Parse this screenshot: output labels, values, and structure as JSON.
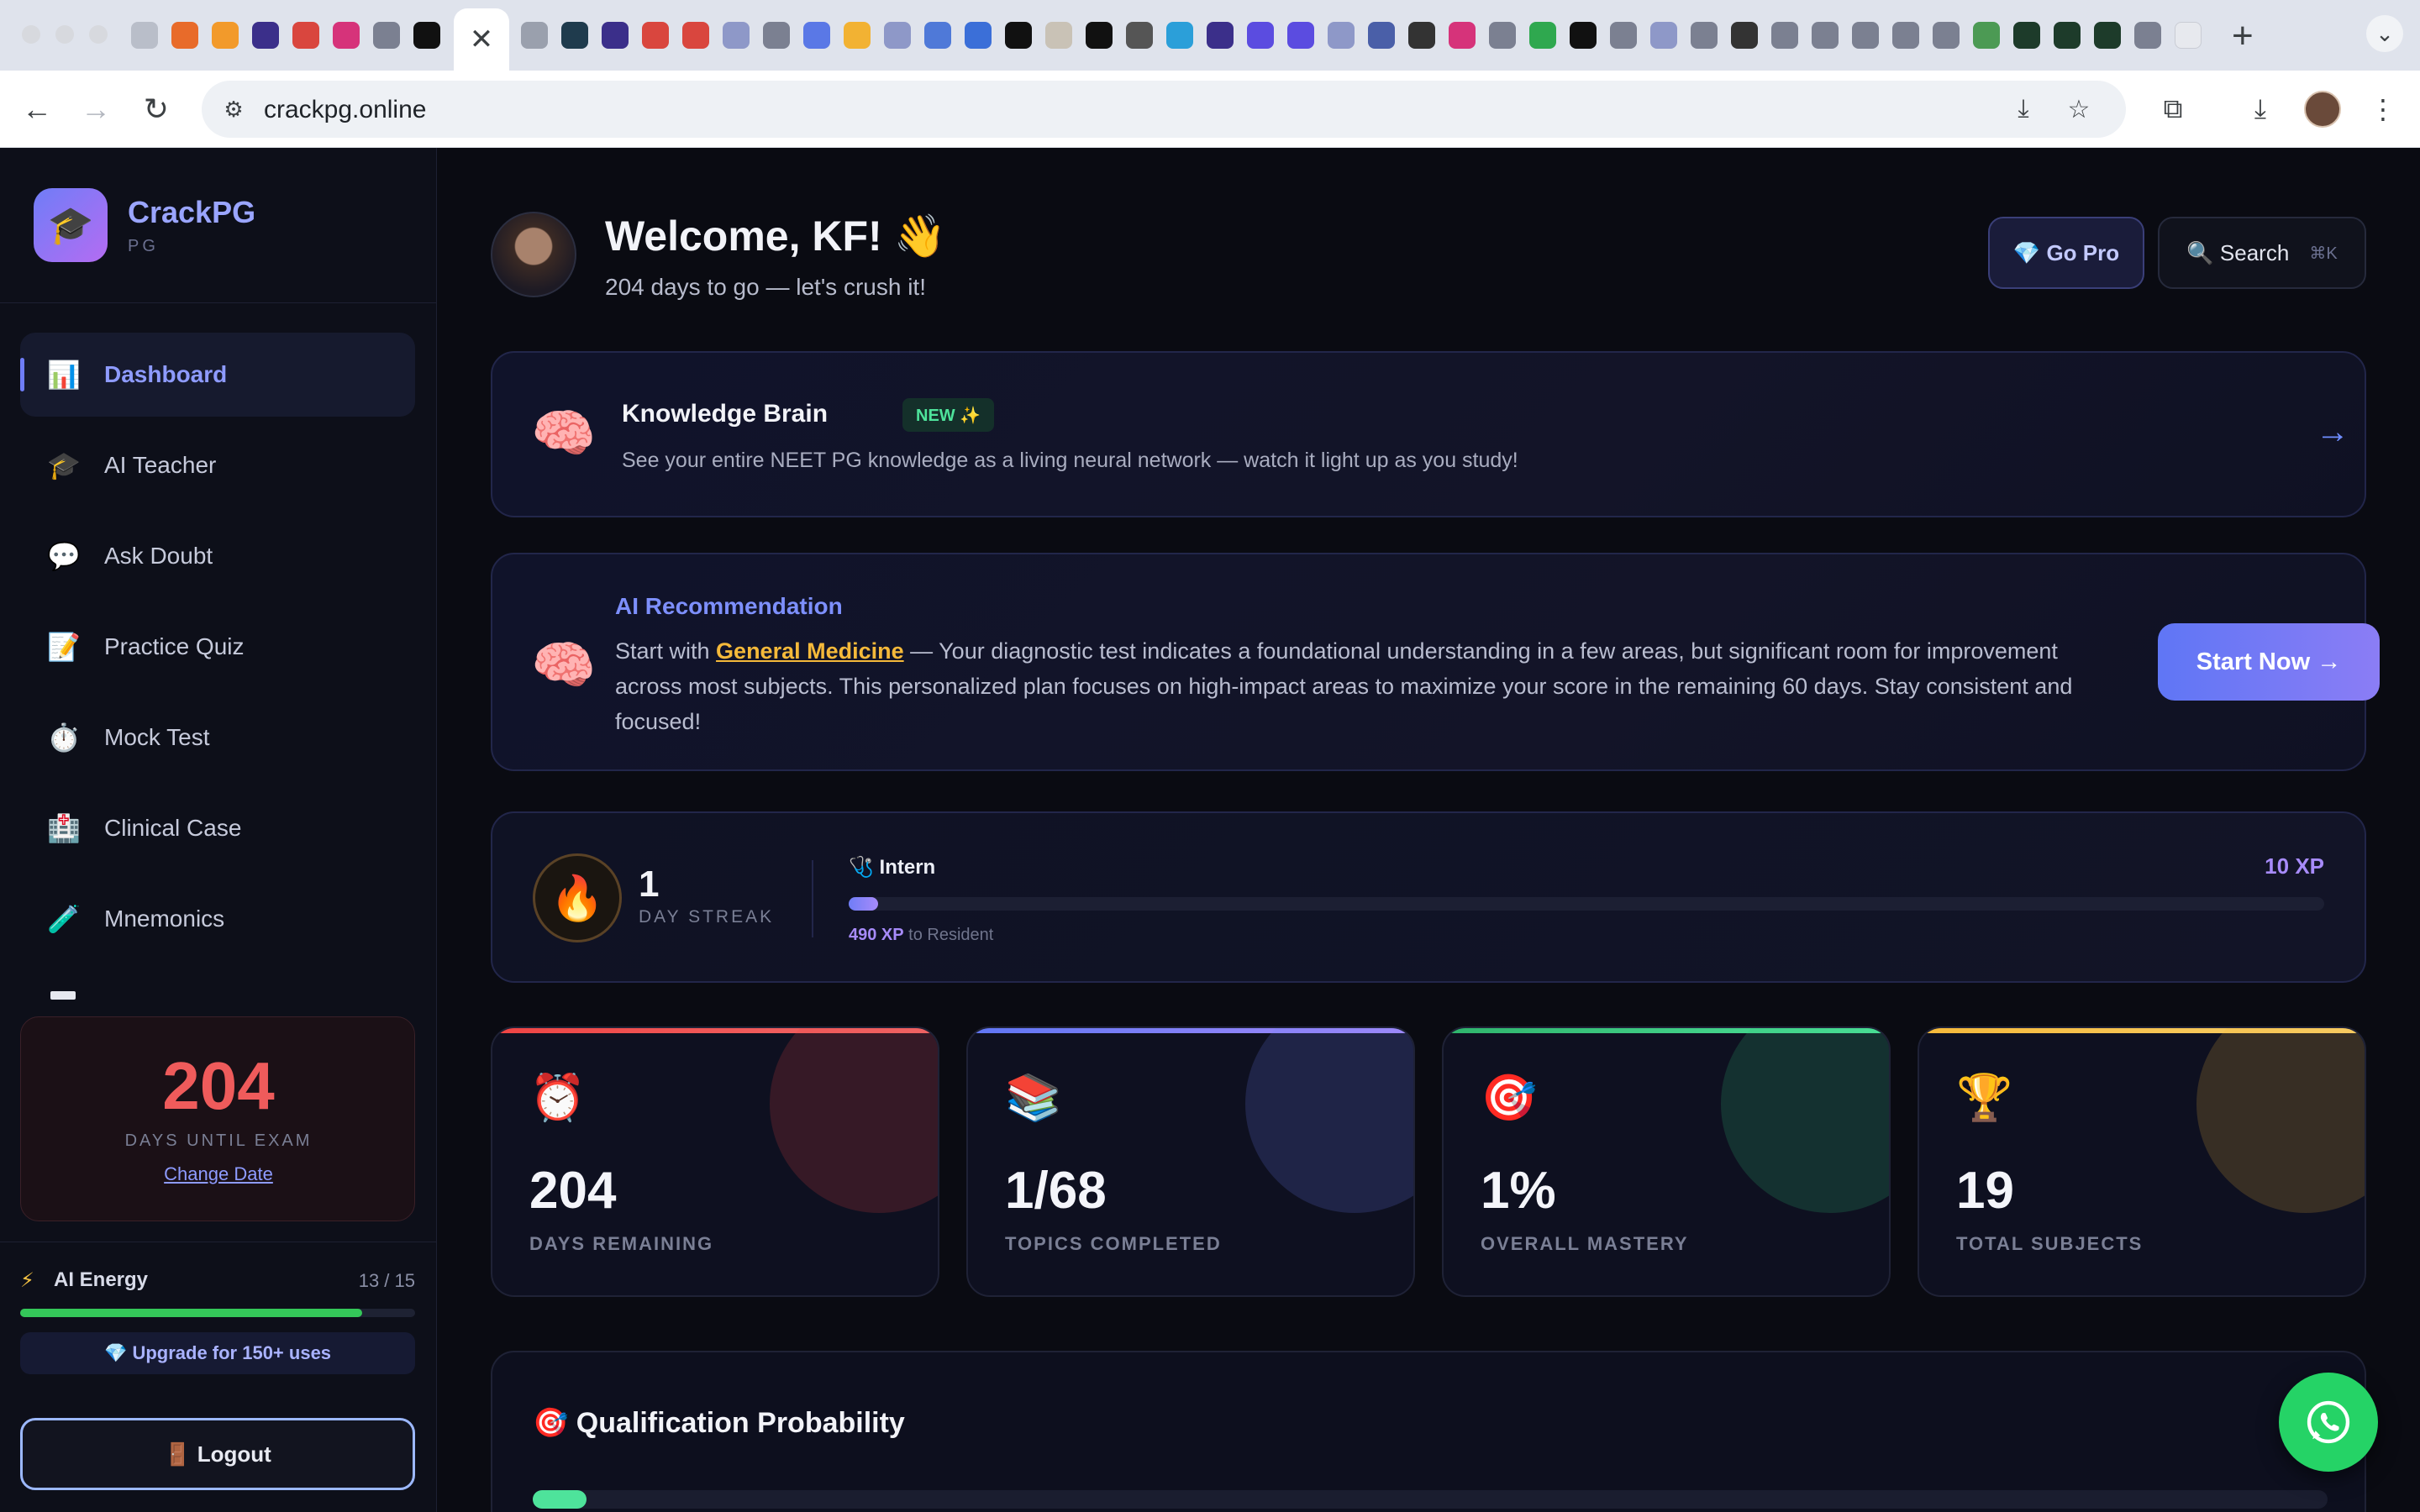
{
  "browser": {
    "active_tab_close": "✕",
    "url": "crackpg.online"
  },
  "sidebar": {
    "brand_name": "CrackPG",
    "brand_sub": "PG",
    "items": [
      {
        "label": "Dashboard",
        "icon": "📊"
      },
      {
        "label": "AI Teacher",
        "icon": "🎓"
      },
      {
        "label": "Ask Doubt",
        "icon": "💬"
      },
      {
        "label": "Practice Quiz",
        "icon": "📝"
      },
      {
        "label": "Mock Test",
        "icon": "⏱️"
      },
      {
        "label": "Clinical Case",
        "icon": "🏥"
      },
      {
        "label": "Mnemonics",
        "icon": "🧪"
      }
    ],
    "countdown": {
      "value": "204",
      "label": "DAYS UNTIL EXAM",
      "link": "Change Date"
    },
    "energy": {
      "title": "AI Energy",
      "count": "13 / 15",
      "fraction": 0.867,
      "upgrade": "💎 Upgrade for 150+ uses"
    },
    "logout": "🚪 Logout"
  },
  "header": {
    "welcome": "Welcome, KF! 👋",
    "subtitle": "204 days to go — let's crush it!",
    "go_pro": "💎 Go Pro",
    "search": "🔍 Search",
    "search_kbd": "⌘K"
  },
  "knowledge_brain": {
    "icon": "🧠",
    "title": "Knowledge Brain",
    "badge": "NEW ✨",
    "description": "See your entire NEET PG knowledge as a living neural network — watch it light up as you study!",
    "arrow": "→"
  },
  "ai_recommendation": {
    "icon": "🧠",
    "title": "AI Recommendation",
    "text_prefix": "Start with ",
    "subject": "General Medicine",
    "text_suffix": " — Your diagnostic test indicates a foundational understanding in a few areas, but significant room for improvement across most subjects. This personalized plan focuses on high-impact areas to maximize your score in the remaining 60 days. Stay consistent and focused!",
    "button": "Start Now →"
  },
  "streak": {
    "icon": "🔥",
    "value": "1",
    "label": "DAY STREAK",
    "rank": "🩺 Intern",
    "xp": "10 XP",
    "xp_progress": 0.02,
    "xp_needed": "490 XP",
    "xp_next": " to Resident"
  },
  "stats": [
    {
      "icon": "⏰",
      "value": "204",
      "label": "DAYS REMAINING",
      "color": "#ef4444"
    },
    {
      "icon": "📚",
      "value": "1/68",
      "label": "TOPICS COMPLETED",
      "color": "#6f7df7"
    },
    {
      "icon": "🎯",
      "value": "1%",
      "label": "OVERALL MASTERY",
      "color": "#34c77b"
    },
    {
      "icon": "🏆",
      "value": "19",
      "label": "TOTAL SUBJECTS",
      "color": "#f5b93a"
    }
  ],
  "qualification": {
    "title": "🎯 Qualification Probability",
    "value": "5",
    "progress": 0.03
  },
  "colors": {
    "accent": "#6f7df7",
    "danger": "#ef5b5b",
    "success": "#4ee39b",
    "whatsapp": "#25d366"
  }
}
